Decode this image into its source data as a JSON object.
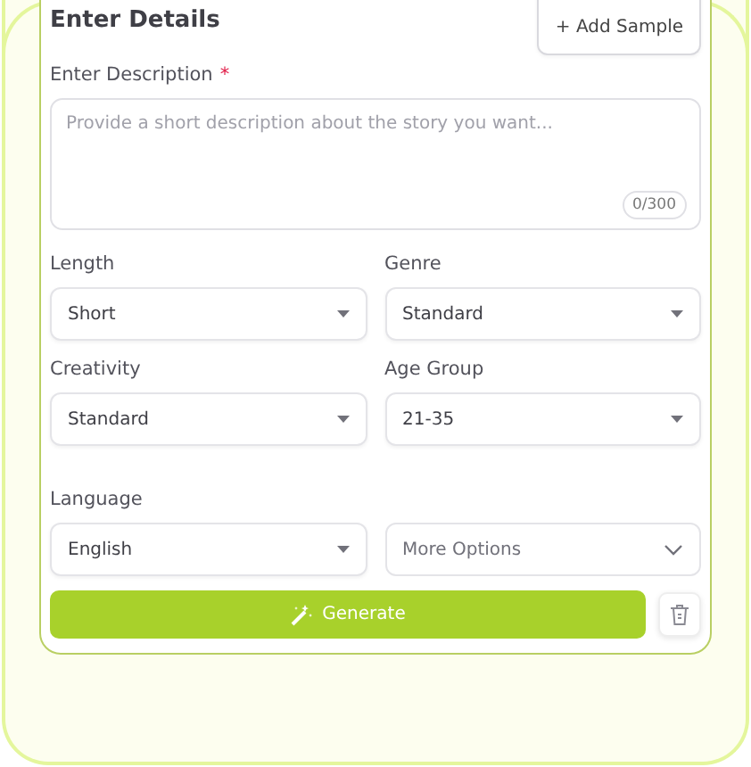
{
  "section": {
    "title": "Enter Details",
    "add_sample_button": "+ Add Sample"
  },
  "description": {
    "label": "Enter Description",
    "required_mark": "*",
    "placeholder": "Provide a short description about the story you want...",
    "counter": "0/300"
  },
  "fields": [
    {
      "label": "Length",
      "value": "Short",
      "kind": "select"
    },
    {
      "label": "Genre",
      "value": "Standard",
      "kind": "select"
    },
    {
      "label": "Creativity",
      "value": "Standard",
      "kind": "select"
    },
    {
      "label": "Age Group",
      "value": "21-35",
      "kind": "select"
    },
    {
      "label": "Language",
      "value": "English",
      "kind": "select"
    },
    {
      "value": "More Options",
      "kind": "expander"
    }
  ],
  "generate_button": "Generate"
}
